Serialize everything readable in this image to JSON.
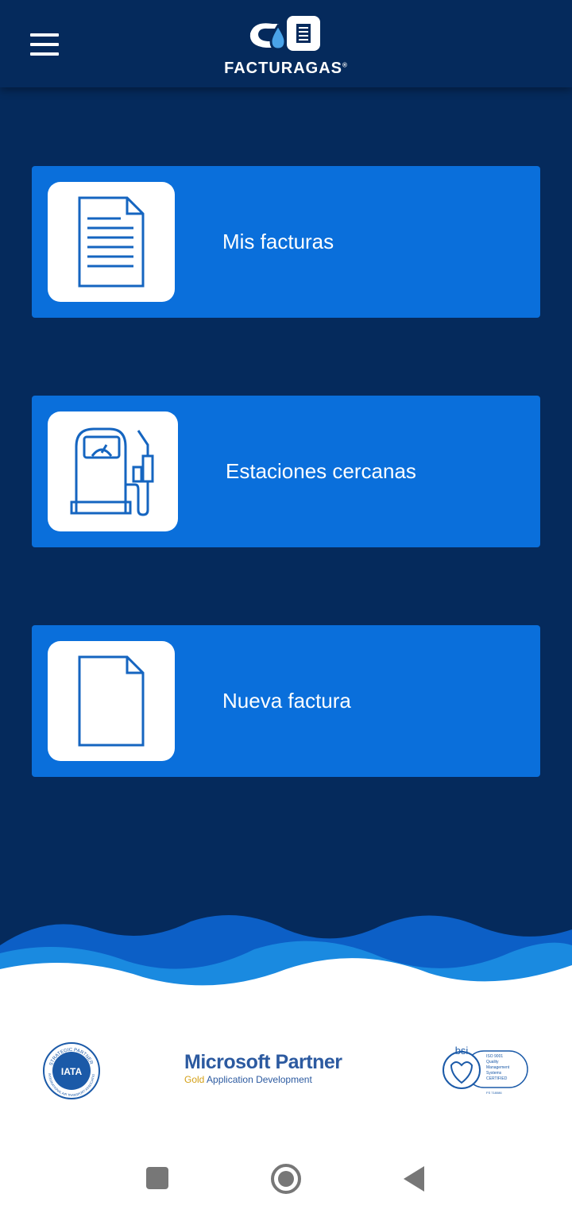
{
  "header": {
    "brand": "FACTURAGAS",
    "trademark": "®",
    "logo_badge": "CB",
    "menu_icon": "hamburger-menu-icon"
  },
  "menu": {
    "items": [
      {
        "label": "Mis facturas",
        "icon": "document-lines-icon"
      },
      {
        "label": "Estaciones cercanas",
        "icon": "gas-pump-icon"
      },
      {
        "label": "Nueva factura",
        "icon": "blank-document-icon"
      }
    ]
  },
  "footer": {
    "iata": {
      "top_text": "STRATEGIC PARTNER",
      "center_text": "IATA",
      "bottom_text": "INTERNATIONAL AIR TRANSPORT ASSOCIATION"
    },
    "microsoft": {
      "title": "Microsoft Partner",
      "level": "Gold",
      "competency": "Application Development"
    },
    "bsi": {
      "brand": "bsi",
      "lines": [
        "ISO 9001",
        "Quality",
        "Management",
        "Systems",
        "CERTIFIED"
      ],
      "code": "FS 718086"
    }
  },
  "colors": {
    "background": "#052a5c",
    "card": "#0a6fdb",
    "icon_stroke": "#1565c0",
    "wave_light": "#1a8ae0",
    "wave_mid": "#0c5fc6"
  },
  "system_nav": {
    "recents_icon": "square-recents-icon",
    "home_icon": "circle-home-icon",
    "back_icon": "triangle-back-icon"
  }
}
